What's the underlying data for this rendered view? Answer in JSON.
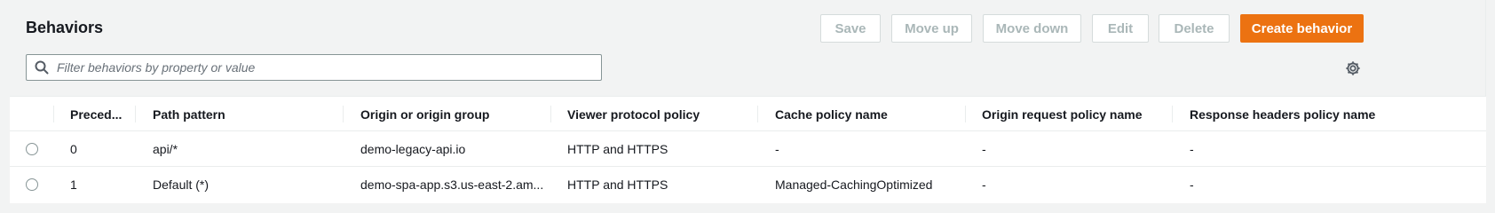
{
  "panel": {
    "title": "Behaviors"
  },
  "toolbar": {
    "save_label": "Save",
    "move_up_label": "Move up",
    "move_down_label": "Move down",
    "edit_label": "Edit",
    "delete_label": "Delete",
    "create_label": "Create behavior"
  },
  "search": {
    "placeholder": "Filter behaviors by property or value",
    "value": ""
  },
  "table": {
    "columns": [
      "Preced...",
      "Path pattern",
      "Origin or origin group",
      "Viewer protocol policy",
      "Cache policy name",
      "Origin request policy name",
      "Response headers policy name"
    ],
    "rows": [
      {
        "precedence": "0",
        "path": "api/*",
        "origin": "demo-legacy-api.io",
        "viewer_protocol": "HTTP and HTTPS",
        "cache_policy": "-",
        "origin_request_policy": "-",
        "response_headers_policy": "-"
      },
      {
        "precedence": "1",
        "path": "Default (*)",
        "origin": "demo-spa-app.s3.us-east-2.am...",
        "viewer_protocol": "HTTP and HTTPS",
        "cache_policy": "Managed-CachingOptimized",
        "origin_request_policy": "-",
        "response_headers_policy": "-"
      }
    ]
  },
  "colors": {
    "primary": "#ec7211",
    "disabled_text": "#aab7b8",
    "border": "#d5dbdb"
  },
  "icons": {
    "search": "search-icon",
    "settings": "gear-icon"
  }
}
